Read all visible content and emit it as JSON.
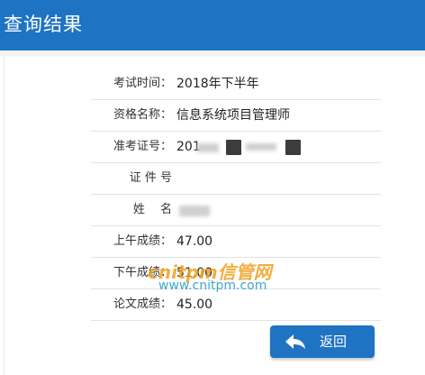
{
  "header": {
    "title": "查询结果"
  },
  "results": [
    {
      "label": "考试时间：",
      "value": "2018年下半年"
    },
    {
      "label": "资格名称：",
      "value": "信息系统项目管理师"
    },
    {
      "label": "准考证号：",
      "value": "201"
    },
    {
      "label": "证 件 号",
      "value": ""
    },
    {
      "label": "姓　 名",
      "value": ""
    },
    {
      "label": "上午成绩：",
      "value": "47.00"
    },
    {
      "label": "下午成绩：",
      "value": "51.00"
    },
    {
      "label": "论文成绩：",
      "value": "45.00"
    }
  ],
  "watermark": {
    "brand": "cnitpm信管网",
    "url": "www.cnitpm.com"
  },
  "actions": {
    "back_label": "返回"
  },
  "colors": {
    "header_bg": "#1e73c2",
    "button_bg": "#1e73c2",
    "watermark_brand": "#f0a020",
    "watermark_url": "#2aa0c8"
  },
  "icons": {
    "back": "back-arrow-icon"
  }
}
